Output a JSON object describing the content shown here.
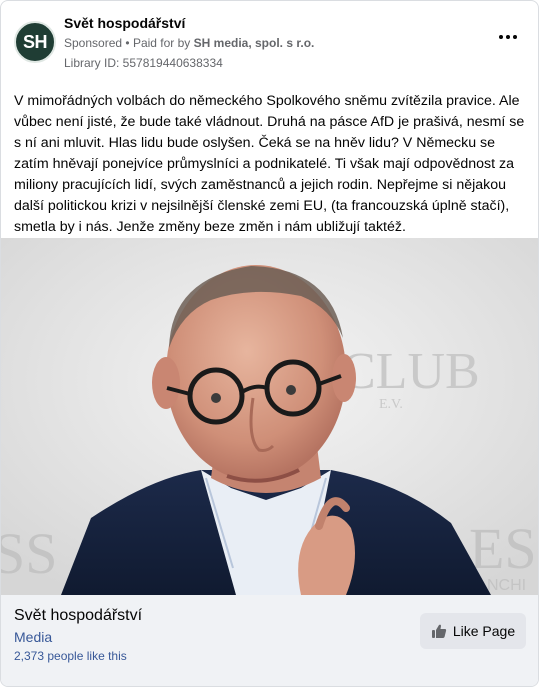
{
  "post": {
    "page_name": "Svět hospodářství",
    "avatar_initials": "SH",
    "sponsored_label": "Sponsored",
    "paid_for_prefix": "Paid for by",
    "payer": "SH media, spol. s r.o.",
    "library_id": "Library ID: 557819440638334",
    "body": "V mimořádných volbách do německého Spolkového sněmu zvítězila pravice. Ale vůbec není jisté, že bude také vládnout. Druhá na pásce AfD je prašivá, nesmí se s ní ani mluvit. Hlas lidu bude oslyšen. Čeká se na hněv lidu? V Německu se zatím hněvají ponejvíce průmyslníci a podnikatelé. Ti však mají odpovědnost za miliony pracujících lidí, svých zaměstnanců a jejich rodin. Nepřejme si nějakou další politickou krizi v nejsilnější členské zemi EU, (ta francouzská úplně stačí), smetla by i nás. Jenže změny beze změn i nám ubližují taktéž."
  },
  "image": {
    "backdrop_text_club": "CLUB",
    "backdrop_text_ev": "E.V.",
    "backdrop_text_left": "SS",
    "backdrop_text_right": "ESS",
    "backdrop_text_right_small": "NCHI"
  },
  "footer": {
    "page_name": "Svět hospodářství",
    "category": "Media",
    "likes": "2,373 people like this",
    "like_button": "Like Page"
  },
  "colors": {
    "avatar_bg": "#1f3d34",
    "link_blue": "#385898",
    "footer_bg": "#f0f2f5"
  }
}
